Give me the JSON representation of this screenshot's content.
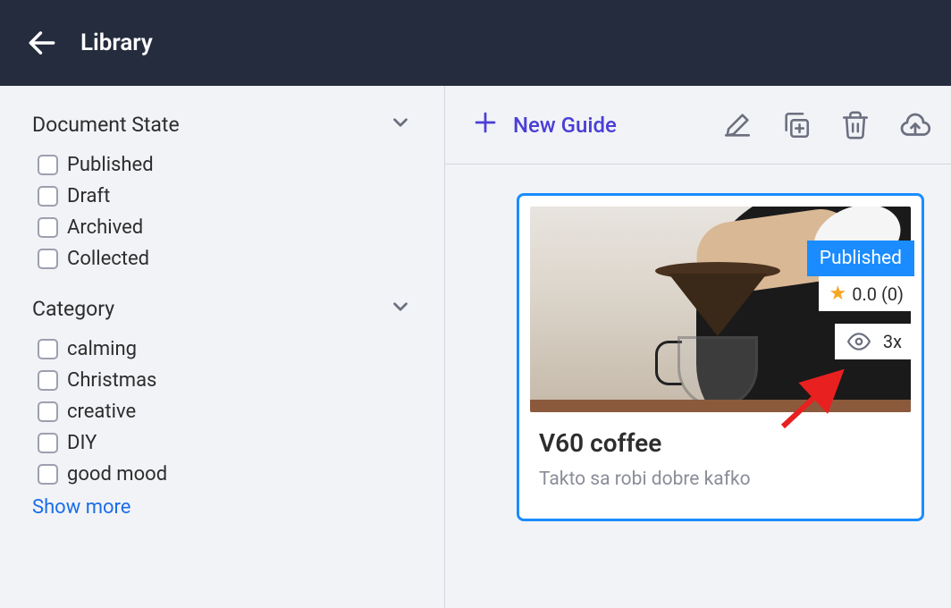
{
  "header": {
    "title": "Library"
  },
  "sidebar": {
    "sections": [
      {
        "title": "Document State",
        "options": [
          {
            "label": "Published"
          },
          {
            "label": "Draft"
          },
          {
            "label": "Archived"
          },
          {
            "label": "Collected"
          }
        ]
      },
      {
        "title": "Category",
        "options": [
          {
            "label": "calming"
          },
          {
            "label": "Christmas"
          },
          {
            "label": "creative"
          },
          {
            "label": "DIY"
          },
          {
            "label": "good mood"
          }
        ],
        "show_more": "Show more"
      }
    ]
  },
  "toolbar": {
    "new_guide_label": "New Guide"
  },
  "card": {
    "status": "Published",
    "rating": "0.0 (0)",
    "views": "3x",
    "title": "V60 coffee",
    "description": "Takto sa robi dobre kafko"
  }
}
